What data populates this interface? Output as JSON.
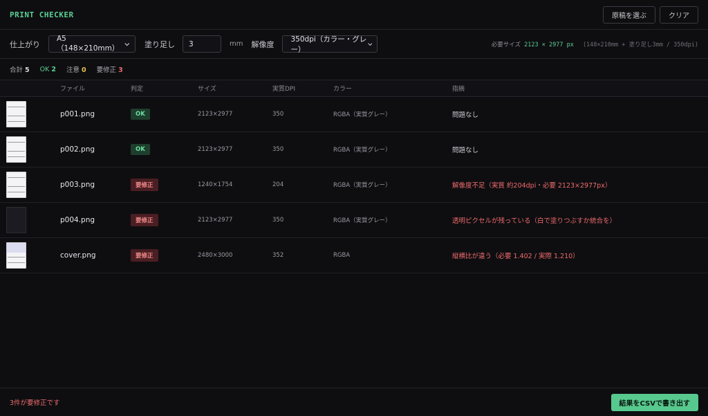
{
  "app": {
    "title": "PRINT CHECKER"
  },
  "header": {
    "choose_label": "原稿を選ぶ",
    "clear_label": "クリア"
  },
  "settings": {
    "finish_label": "仕上がり",
    "finish_value": "A5（148×210mm）",
    "bleed_label": "塗り足し",
    "bleed_value": "3",
    "bleed_unit": "mm",
    "resolution_label": "解像度",
    "resolution_value": "350dpi（カラー・グレー）",
    "required_label": "必要サイズ",
    "required_w": "2123",
    "required_x": "×",
    "required_h": "2977 px",
    "required_detail": "(148×210mm + 塗り足し3mm / 350dpi)"
  },
  "summary": {
    "total_label": "合計",
    "total_value": "5",
    "ok_label": "OK",
    "ok_value": "2",
    "warn_label": "注意",
    "warn_value": "0",
    "bad_label": "要修正",
    "bad_value": "3"
  },
  "table": {
    "headers": {
      "file": "ファイル",
      "judge": "判定",
      "size": "サイズ",
      "dpi": "実質DPI",
      "color": "カラー",
      "note": "指摘"
    },
    "rows": [
      {
        "file": "p001.png",
        "judge": "OK",
        "size": "2123×2977",
        "dpi": "350",
        "color": "RGBA（実質グレー）",
        "note": "問題なし",
        "thumb": "white"
      },
      {
        "file": "p002.png",
        "judge": "OK",
        "size": "2123×2977",
        "dpi": "350",
        "color": "RGBA（実質グレー）",
        "note": "問題なし",
        "thumb": "white"
      },
      {
        "file": "p003.png",
        "judge": "要修正",
        "size": "1240×1754",
        "dpi": "204",
        "color": "RGBA（実質グレー）",
        "note": "解像度不足（実質 約204dpi・必要 2123×2977px）",
        "thumb": "white"
      },
      {
        "file": "p004.png",
        "judge": "要修正",
        "size": "2123×2977",
        "dpi": "350",
        "color": "RGBA（実質グレー）",
        "note": "透明ピクセルが残っている（白で塗りつぶすか統合を）",
        "thumb": "dark"
      },
      {
        "file": "cover.png",
        "judge": "要修正",
        "size": "2480×3000",
        "dpi": "352",
        "color": "RGBA",
        "note": "縦横比が違う（必要 1.402 / 実際 1.210）",
        "thumb": "cover"
      }
    ]
  },
  "footer": {
    "status": "3件が要修正です",
    "export_label": "結果をCSVで書き出す"
  },
  "colors": {
    "accent": "#5ccf94",
    "ok": "#5ccf94",
    "warn": "#e3c14f",
    "bad": "#ef6b6b"
  }
}
